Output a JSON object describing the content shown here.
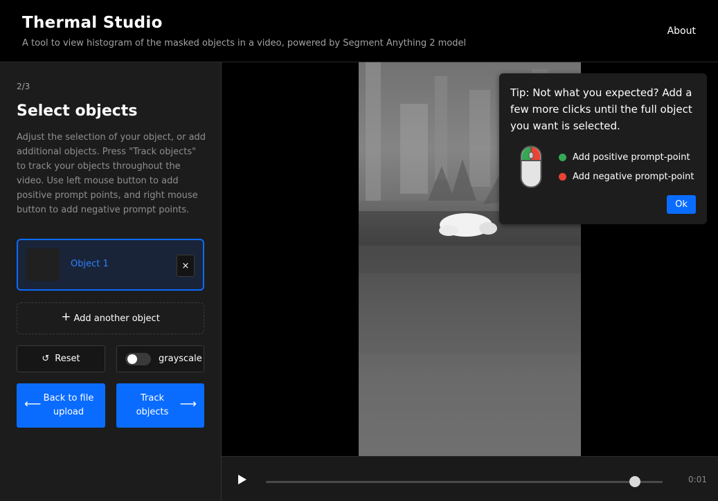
{
  "header": {
    "title": "Thermal Studio",
    "subtitle": "A tool to view histogram of the masked objects in a video, powered by Segment Anything 2 model",
    "about": "About"
  },
  "sidebar": {
    "step": "2/3",
    "heading": "Select objects",
    "description": "Adjust the selection of your object, or add additional objects. Press \"Track objects\" to track your objects throughout the video. Use left mouse button to add positive prompt points, and right mouse button to add negative prompt points.",
    "objects": [
      {
        "label": "Object 1",
        "remove": "×"
      }
    ],
    "add_object": {
      "icon": "+",
      "label": "Add another object"
    },
    "reset": {
      "icon": "↺",
      "label": "Reset"
    },
    "grayscale": {
      "label": "grayscale",
      "enabled": false
    },
    "back": {
      "icon": "⟵",
      "label": "Back to file upload"
    },
    "track": {
      "icon": "⟶",
      "label": "Track objects"
    }
  },
  "player": {
    "play_icon": "▶",
    "time": "0:01",
    "progress_percent": 93
  },
  "tip": {
    "text": "Tip: Not what you expected? Add a few more clicks until the full object you want is selected.",
    "positive": {
      "label": "Add positive prompt-point",
      "color": "#34a853"
    },
    "negative": {
      "label": "Add negative prompt-point",
      "color": "#ea4335"
    },
    "ok": "Ok"
  },
  "colors": {
    "accent": "#0a6cff",
    "background": "#000000",
    "panel": "#1c1c1c"
  }
}
